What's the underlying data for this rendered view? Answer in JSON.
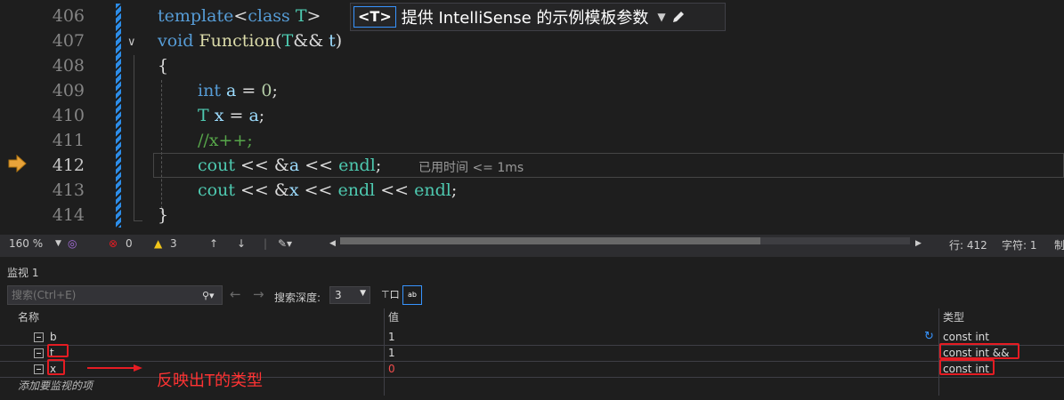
{
  "editor": {
    "lines": [
      {
        "num": "406",
        "text": "template<class T>"
      },
      {
        "num": "407",
        "text": "void Function(T&& t)"
      },
      {
        "num": "408",
        "text": "{"
      },
      {
        "num": "409",
        "text": "int a = 0;"
      },
      {
        "num": "410",
        "text": "T x = a;"
      },
      {
        "num": "411",
        "text": "//x++;"
      },
      {
        "num": "412",
        "text": "cout << &a << endl;"
      },
      {
        "num": "413",
        "text": "cout << &x << endl << endl;"
      },
      {
        "num": "414",
        "text": "}"
      }
    ],
    "elapsed_hint": "已用时间 <= 1ms",
    "template_bar": {
      "badge": "<T>",
      "text": "提供 IntelliSense 的示例模板参数"
    }
  },
  "status": {
    "zoom": "160 %",
    "errors": "0",
    "warnings": "3",
    "line": "行: 412",
    "col": "字符: 1",
    "mode": "制"
  },
  "watch": {
    "title": "监视 1",
    "search_placeholder": "搜索(Ctrl+E)",
    "depth_label": "搜索深度:",
    "depth_value": "3",
    "columns": {
      "name": "名称",
      "value": "值",
      "type": "类型"
    },
    "rows": [
      {
        "name": "b",
        "value": "1",
        "type": "const int"
      },
      {
        "name": "t",
        "value": "1",
        "type": "const int &&"
      },
      {
        "name": "x",
        "value": "0",
        "type": "const int"
      }
    ],
    "add_item": "添加要监视的项"
  },
  "annotation": {
    "text": "反映出T的类型",
    "color": "#e51c23"
  },
  "colors": {
    "keyword": "#569cd6",
    "type": "#4ec9b0",
    "function": "#dcdcaa",
    "number": "#b5cea8",
    "comment": "#57a64a",
    "changed_value": "#f14c4c"
  }
}
